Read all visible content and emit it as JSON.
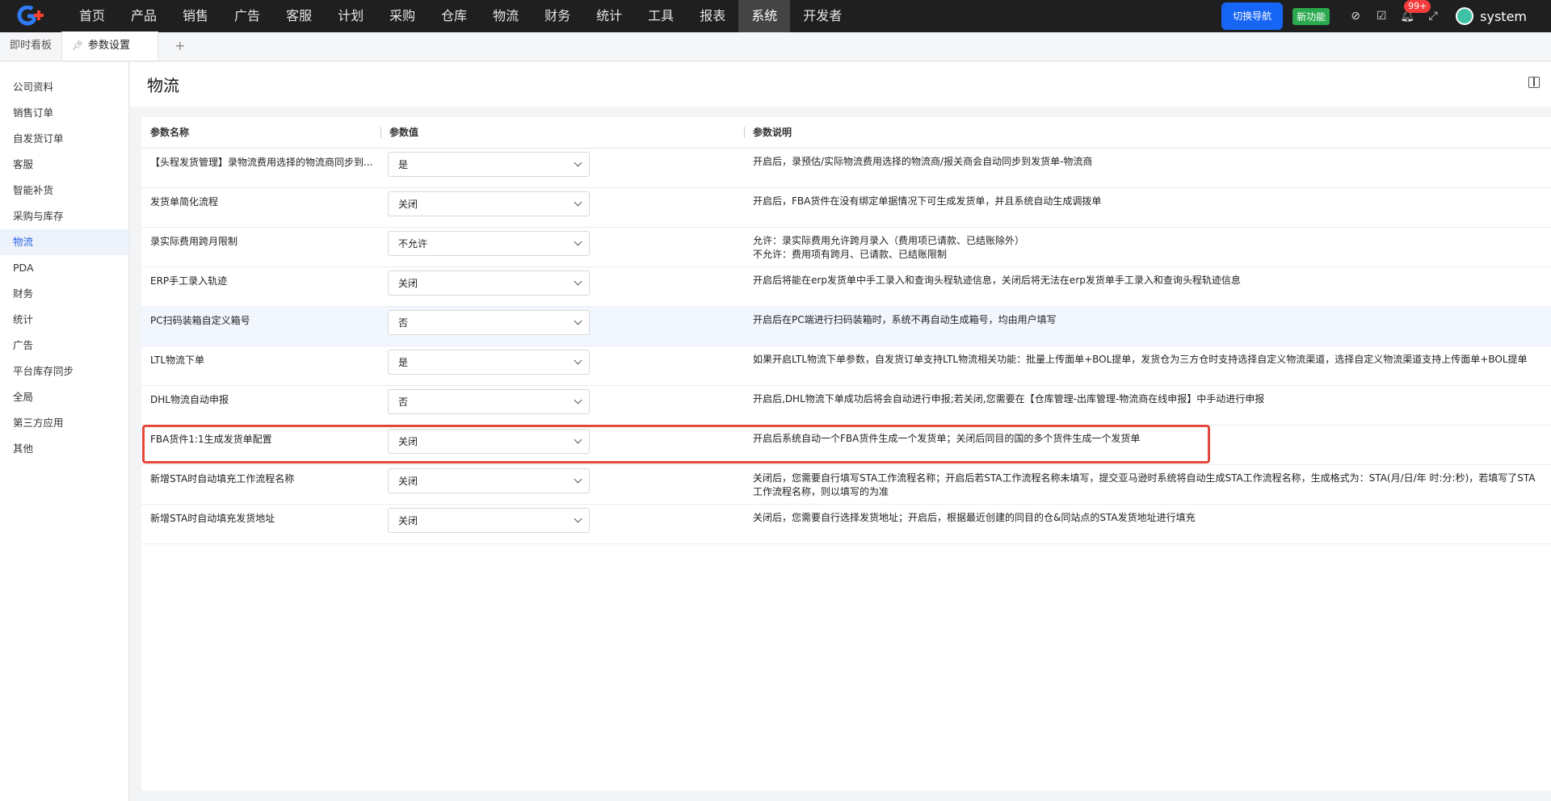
{
  "topnav": {
    "items": [
      "首页",
      "产品",
      "销售",
      "广告",
      "客服",
      "计划",
      "采购",
      "仓库",
      "物流",
      "财务",
      "统计",
      "工具",
      "报表",
      "系统",
      "开发者"
    ],
    "active": "系统",
    "switch_nav": "切换导航",
    "new_feature": "新功能",
    "notif_count": "99+",
    "user": "system"
  },
  "tabs": {
    "dashboard": "即时看板",
    "params": "参数设置",
    "add": "+"
  },
  "sidebar": {
    "items": [
      "公司资料",
      "销售订单",
      "自发货订单",
      "客服",
      "智能补货",
      "采购与库存",
      "物流",
      "PDA",
      "财务",
      "统计",
      "广告",
      "平台库存同步",
      "全局",
      "第三方应用",
      "其他"
    ],
    "active": "物流"
  },
  "page": {
    "title": "物流"
  },
  "table": {
    "headers": [
      "参数名称",
      "参数值",
      "参数说明"
    ],
    "rows": [
      {
        "name": "【头程发货管理】录物流费用选择的物流商同步到...",
        "value": "是",
        "desc": [
          "开启后，录预估/实际物流费用选择的物流商/报关商会自动同步到发货单-物流商"
        ]
      },
      {
        "name": "发货单简化流程",
        "value": "关闭",
        "desc": [
          "开启后，FBA货件在没有绑定单据情况下可生成发货单，并且系统自动生成调拨单"
        ]
      },
      {
        "name": "录实际费用跨月限制",
        "value": "不允许",
        "desc": [
          "允许：录实际费用允许跨月录入（费用项已请款、已结账除外）",
          "不允许：费用项有跨月、已请款、已结账限制"
        ]
      },
      {
        "name": "ERP手工录入轨迹",
        "value": "关闭",
        "desc": [
          "开启后将能在erp发货单中手工录入和查询头程轨迹信息，关闭后将无法在erp发货单手工录入和查询头程轨迹信息"
        ]
      },
      {
        "name": "PC扫码装箱自定义箱号",
        "value": "否",
        "desc": [
          "开启后在PC端进行扫码装箱时，系统不再自动生成箱号，均由用户填写"
        ]
      },
      {
        "name": "LTL物流下单",
        "value": "是",
        "desc": [
          "如果开启LTL物流下单参数，自发货订单支持LTL物流相关功能：批量上传面单+BOL提单，发货仓为三方仓时支持选择自定义物流渠道，选择自定义物流渠道支持上传面单+BOL提单"
        ]
      },
      {
        "name": "DHL物流自动申报",
        "value": "否",
        "desc": [
          "开启后,DHL物流下单成功后将会自动进行申报;若关闭,您需要在【仓库管理-出库管理-物流商在线申报】中手动进行申报"
        ]
      },
      {
        "name": "FBA货件1:1生成发货单配置",
        "value": "关闭",
        "desc": [
          "开启后系统自动一个FBA货件生成一个发货单；关闭后同目的国的多个货件生成一个发货单"
        ]
      },
      {
        "name": "新增STA时自动填充工作流程名称",
        "value": "关闭",
        "desc": [
          "关闭后，您需要自行填写STA工作流程名称；开启后若STA工作流程名称未填写，提交亚马逊时系统将自动生成STA工作流程名称，生成格式为：STA(月/日/年 时:分:秒)，若填写了STA",
          "工作流程名称，则以填写的为准"
        ]
      },
      {
        "name": "新增STA时自动填充发货地址",
        "value": "关闭",
        "desc": [
          "关闭后，您需要自行选择发货地址；开启后，根据最近创建的同目的仓&同站点的STA发货地址进行填充"
        ]
      }
    ]
  }
}
